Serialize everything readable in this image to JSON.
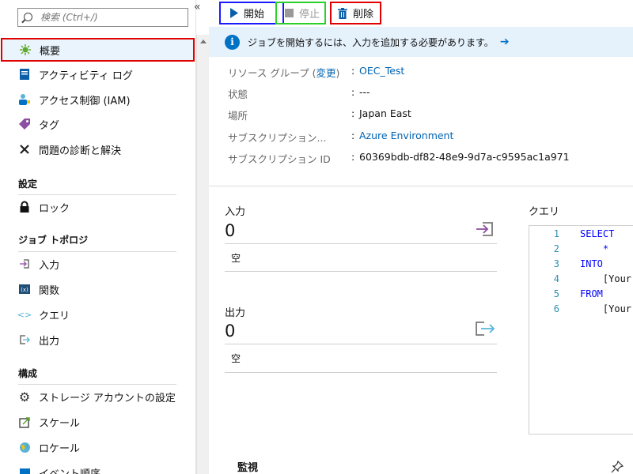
{
  "sidebar": {
    "search_placeholder": "検索 (Ctrl+/)",
    "collapse_glyph": "«",
    "items_top": [
      {
        "label": "概要",
        "selected": true
      },
      {
        "label": "アクティビティ ログ"
      },
      {
        "label": "アクセス制御 (IAM)"
      },
      {
        "label": "タグ"
      },
      {
        "label": "問題の診断と解決"
      }
    ],
    "section_settings": "設定",
    "settings_items": [
      {
        "label": "ロック"
      }
    ],
    "section_topology": "ジョブ トポロジ",
    "topology_items": [
      {
        "label": "入力"
      },
      {
        "label": "関数"
      },
      {
        "label": "クエリ"
      },
      {
        "label": "出力"
      }
    ],
    "section_config": "構成",
    "config_items": [
      {
        "label": "ストレージ アカウントの設定"
      },
      {
        "label": "スケール"
      },
      {
        "label": "ロケール"
      },
      {
        "label": "イベント順序"
      }
    ]
  },
  "toolbar": {
    "start_label": "開始",
    "stop_label": "停止",
    "delete_label": "削除"
  },
  "banner": {
    "text": "ジョブを開始するには、入力を追加する必要があります。"
  },
  "essentials": {
    "resource_group_label": "リソース グループ (",
    "change_label": "変更",
    "resource_group_label_end": ")",
    "resource_group_value": "OEC_Test",
    "status_label": "状態",
    "status_value": "---",
    "location_label": "場所",
    "location_value": "Japan East",
    "subscription_label": "サブスクリプション...",
    "subscription_value": "Azure Environment",
    "subscription_id_label": "サブスクリプション ID",
    "subscription_id_value": "60369bdb-df82-48e9-9d7a-c9595ac1a971",
    "colon": ":"
  },
  "inputs": {
    "title": "入力",
    "count": "0",
    "empty": "空"
  },
  "outputs": {
    "title": "出力",
    "count": "0",
    "empty": "空"
  },
  "query": {
    "title": "クエリ",
    "lines": [
      {
        "num": "1",
        "text": "SELECT",
        "kw": true
      },
      {
        "num": "2",
        "text": "    *",
        "kw": false
      },
      {
        "num": "3",
        "text": "INTO",
        "kw": true
      },
      {
        "num": "4",
        "text": "    [Your",
        "kw": false
      },
      {
        "num": "5",
        "text": "FROM",
        "kw": true
      },
      {
        "num": "6",
        "text": "    [Your",
        "kw": false
      }
    ]
  },
  "monitor": {
    "title": "監視"
  },
  "colors": {
    "accent": "#0072c6",
    "link": "#0063b1",
    "banner_bg": "#e5f1fb",
    "selected_bg": "#eaf4fc"
  }
}
